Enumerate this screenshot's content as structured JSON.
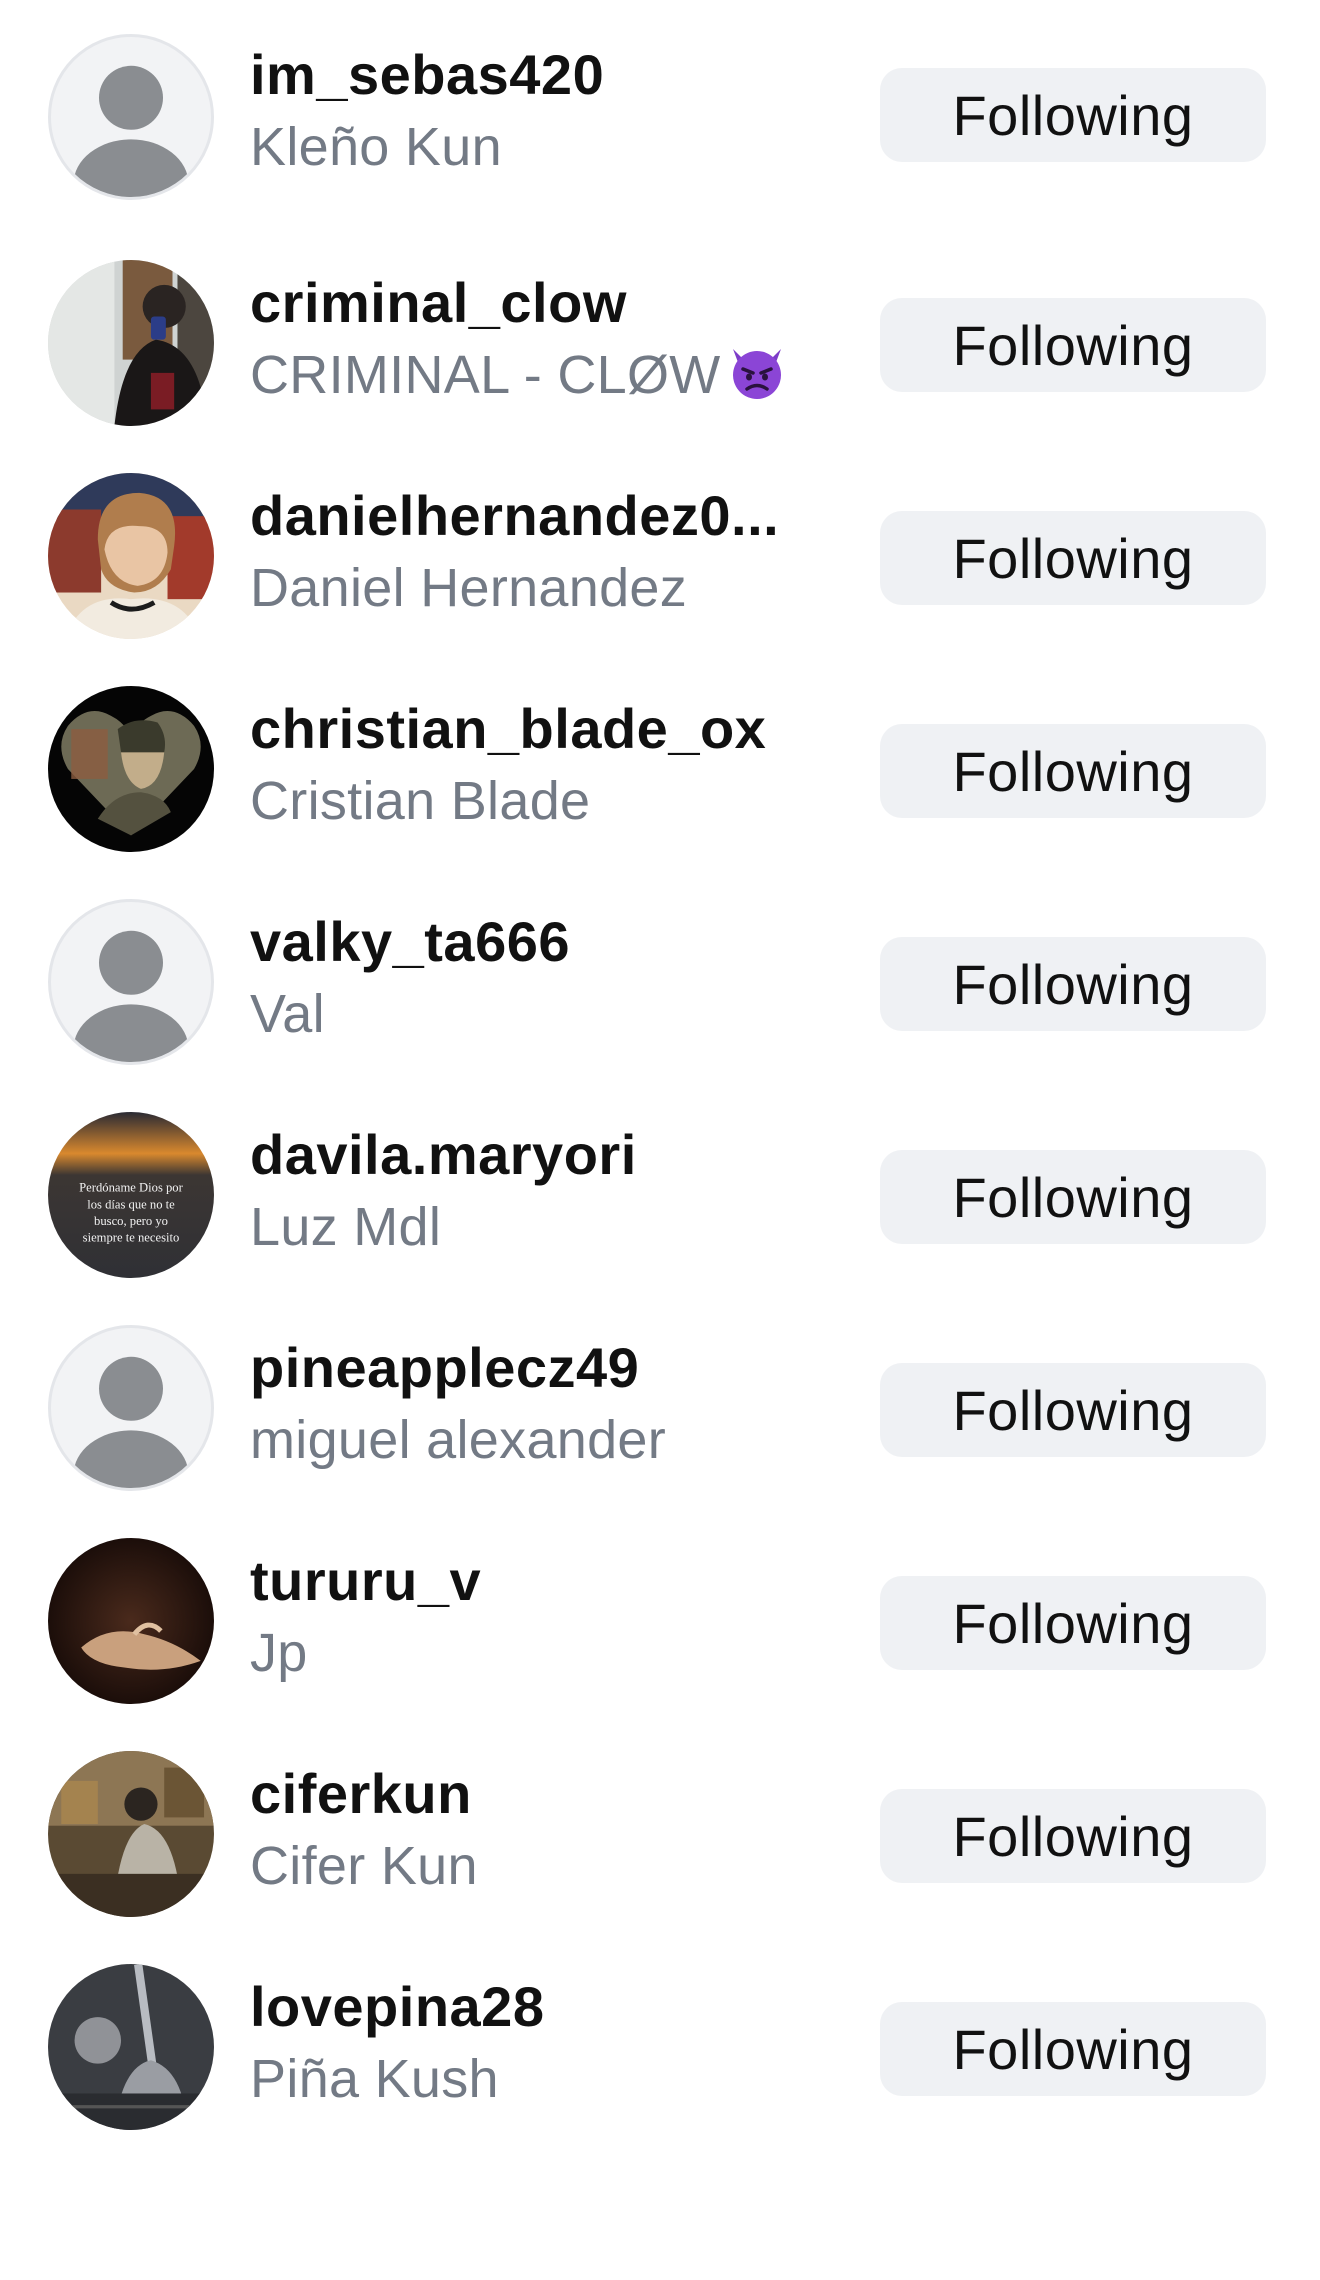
{
  "following_list": [
    {
      "username": "im_sebas420",
      "full_name": "Kleño Kun",
      "button_label": "Following",
      "avatar": "default-avatar-icon"
    },
    {
      "username": "criminal_clow",
      "full_name": "CRIMINAL - CLØW",
      "full_name_emoji": "angry-devil-emoji",
      "button_label": "Following",
      "avatar": "photo"
    },
    {
      "username": "danielhernandez0...",
      "full_name": "Daniel Hernandez",
      "button_label": "Following",
      "avatar": "photo"
    },
    {
      "username": "christian_blade_ox",
      "full_name": "Cristian Blade",
      "button_label": "Following",
      "avatar": "photo"
    },
    {
      "username": "valky_ta666",
      "full_name": "Val",
      "button_label": "Following",
      "avatar": "default-avatar-icon"
    },
    {
      "username": "davila.maryori",
      "full_name": "Luz Mdl",
      "button_label": "Following",
      "avatar": "photo",
      "avatar_text": [
        "Perdóname Dios por",
        "los días que no te",
        "busco, pero yo",
        "siempre te necesito"
      ]
    },
    {
      "username": "pineapplecz49",
      "full_name": "miguel alexander",
      "button_label": "Following",
      "avatar": "default-avatar-icon"
    },
    {
      "username": "tururu_v",
      "full_name": "Jp",
      "button_label": "Following",
      "avatar": "photo"
    },
    {
      "username": "ciferkun",
      "full_name": "Cifer Kun",
      "button_label": "Following",
      "avatar": "photo"
    },
    {
      "username": "lovepina28",
      "full_name": "Piña Kush",
      "button_label": "Following",
      "avatar": "photo"
    }
  ],
  "colors": {
    "username": "#111111",
    "full_name": "#737a85",
    "button_bg": "#eff1f4",
    "default_avatar_fg": "#8a8d91",
    "default_avatar_bg": "#f2f3f5"
  }
}
